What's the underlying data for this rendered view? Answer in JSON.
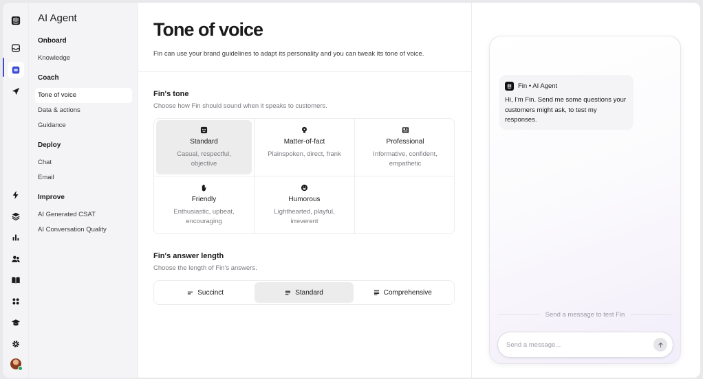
{
  "rail": {
    "items": [
      {
        "icon": "intercom-logo-icon"
      },
      {
        "icon": "inbox-icon"
      },
      {
        "icon": "ai-agent-icon"
      },
      {
        "icon": "outbound-icon"
      },
      {
        "icon": "lightning-icon"
      },
      {
        "icon": "layers-icon"
      },
      {
        "icon": "reports-icon"
      },
      {
        "icon": "contacts-icon"
      },
      {
        "icon": "knowledge-book-icon"
      },
      {
        "icon": "apps-grid-icon"
      },
      {
        "icon": "academy-icon"
      },
      {
        "icon": "settings-gear-icon"
      }
    ],
    "accent": "#3b4bd8"
  },
  "nav": {
    "title": "AI Agent",
    "sections": [
      {
        "label": "Onboard",
        "items": [
          "Knowledge"
        ]
      },
      {
        "label": "Coach",
        "items": [
          "Tone of voice",
          "Data & actions",
          "Guidance"
        ]
      },
      {
        "label": "Deploy",
        "items": [
          "Chat",
          "Email"
        ]
      },
      {
        "label": "Improve",
        "items": [
          "AI Generated CSAT",
          "AI Conversation Quality"
        ]
      }
    ],
    "active_item": "Tone of voice"
  },
  "main": {
    "title": "Tone of voice",
    "subtitle": "Fin can use your brand guidelines to adapt its personality and you can tweak its tone of voice.",
    "tone": {
      "title": "Fin's tone",
      "subtitle": "Choose how Fin should sound when it speaks to customers.",
      "options": [
        {
          "name": "Standard",
          "desc": "Casual, respectful, objective",
          "icon": "standard-face-icon",
          "selected": true
        },
        {
          "name": "Matter-of-fact",
          "desc": "Plainspoken, direct, frank",
          "icon": "lightbulb-icon",
          "selected": false
        },
        {
          "name": "Professional",
          "desc": "Informative, confident, empathetic",
          "icon": "newspaper-icon",
          "selected": false
        },
        {
          "name": "Friendly",
          "desc": "Enthusiastic, upbeat, encouraging",
          "icon": "waving-hand-icon",
          "selected": false
        },
        {
          "name": "Humorous",
          "desc": "Lighthearted, playful, irreverent",
          "icon": "smiley-icon",
          "selected": false
        }
      ]
    },
    "length": {
      "title": "Fin's answer length",
      "subtitle": "Choose the length of Fin's answers.",
      "options": [
        {
          "label": "Succinct",
          "selected": false
        },
        {
          "label": "Standard",
          "selected": true
        },
        {
          "label": "Comprehensive",
          "selected": false
        }
      ]
    }
  },
  "preview": {
    "sender": "Fin • AI Agent",
    "message": "Hi, I'm Fin. Send me some questions your customers might ask, to test my responses.",
    "hint": "Send a message to test Fin",
    "composer_placeholder": "Send a message..."
  }
}
